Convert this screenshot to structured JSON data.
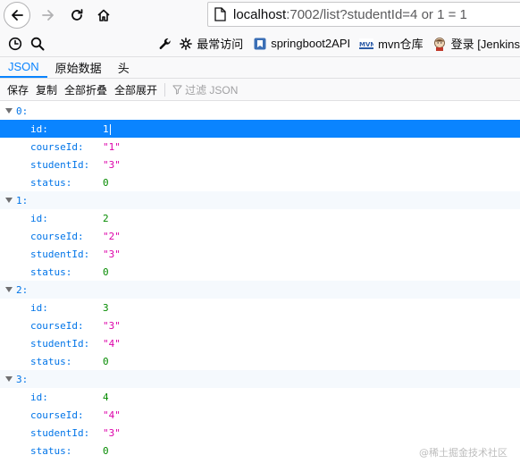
{
  "browser": {
    "url_host": "localhost",
    "url_path": ":7002/list?studentId=4 or 1 = 1"
  },
  "bookmarks": [
    {
      "label": "最常访问",
      "icon": "gear-icon"
    },
    {
      "label": "springboot2API",
      "icon": "bookmark-icon"
    },
    {
      "label": "mvn仓库",
      "icon": "mvn-icon"
    },
    {
      "label": "登录 [Jenkins",
      "icon": "jenkins-icon"
    }
  ],
  "tabs": [
    "JSON",
    "原始数据",
    "头"
  ],
  "toolbar": {
    "save": "保存",
    "copy": "复制",
    "collapse_all": "全部折叠",
    "expand_all": "全部展开",
    "filter_placeholder": "过滤 JSON"
  },
  "records": [
    {
      "index": "0:",
      "id": "1",
      "courseId": "\"1\"",
      "studentId": "\"3\"",
      "status": "0"
    },
    {
      "index": "1:",
      "id": "2",
      "courseId": "\"2\"",
      "studentId": "\"3\"",
      "status": "0"
    },
    {
      "index": "2:",
      "id": "3",
      "courseId": "\"3\"",
      "studentId": "\"4\"",
      "status": "0"
    },
    {
      "index": "3:",
      "id": "4",
      "courseId": "\"4\"",
      "studentId": "\"3\"",
      "status": "0"
    }
  ],
  "keys": {
    "id": "id:",
    "courseId": "courseId:",
    "studentId": "studentId:",
    "status": "status:"
  },
  "watermark": "@稀土掘金技术社区",
  "colors": {
    "accent": "#0a84ff",
    "key": "#0074e8",
    "number": "#058b00",
    "string": "#dd00a9"
  }
}
